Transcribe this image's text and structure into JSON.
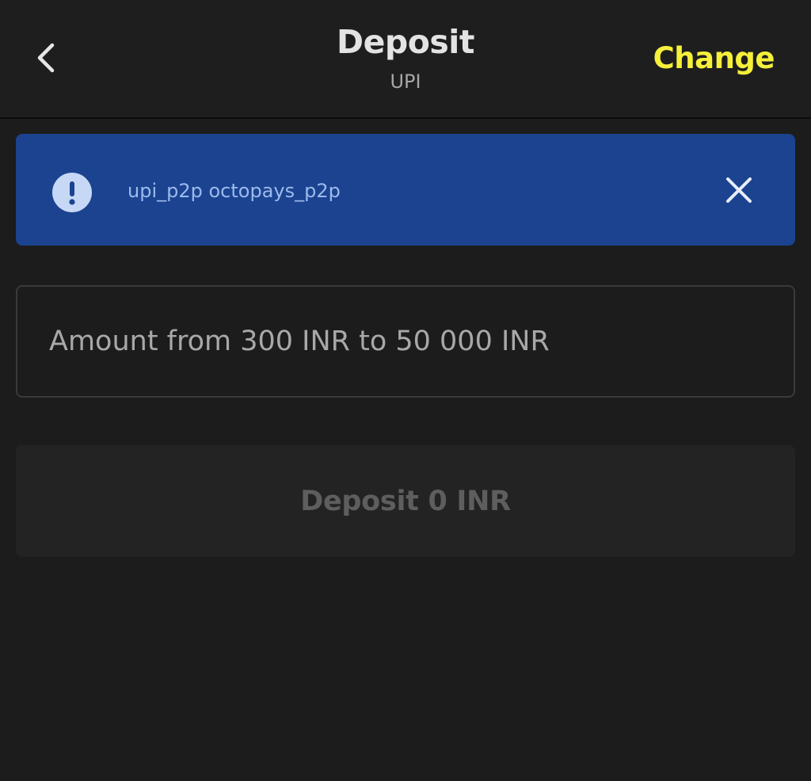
{
  "header": {
    "back_icon": "chevron-left-icon",
    "title": "Deposit",
    "subtitle": "UPI",
    "change_label": "Change"
  },
  "banner": {
    "icon": "exclamation-circle-icon",
    "text": "upi_p2p octopays_p2p",
    "close_icon": "close-icon",
    "background_color": "#1b4390"
  },
  "amount_input": {
    "placeholder": "Amount from 300 INR to 50 000 INR",
    "value": ""
  },
  "deposit_button": {
    "label": "Deposit 0 INR"
  },
  "colors": {
    "background": "#1c1c1c",
    "accent": "#f5f03a",
    "banner": "#1b4390"
  }
}
